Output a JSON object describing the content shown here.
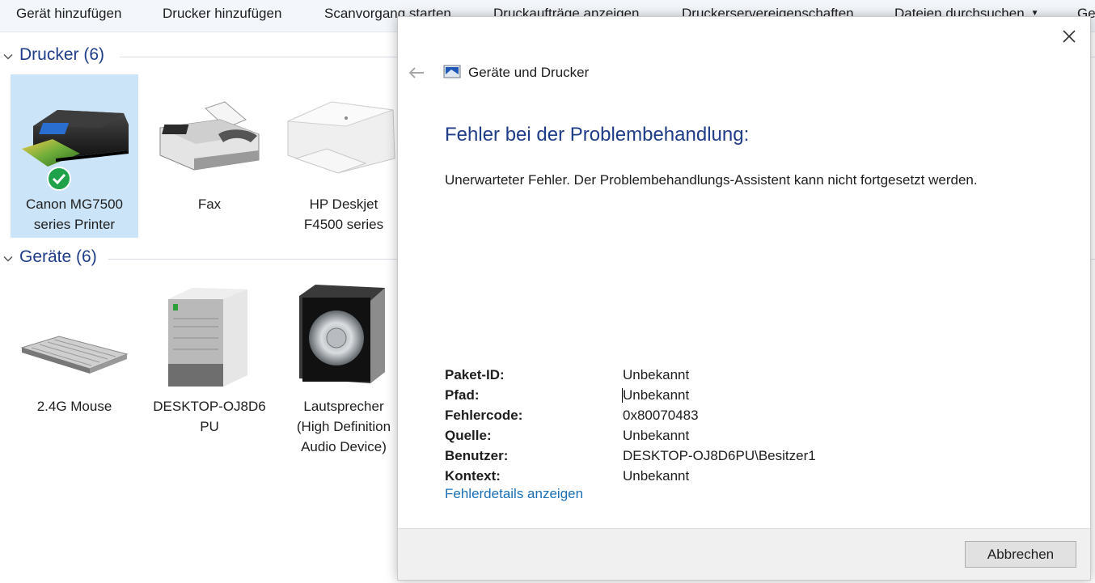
{
  "toolbar": {
    "items": [
      {
        "label": "Gerät hinzufügen"
      },
      {
        "label": "Drucker hinzufügen"
      },
      {
        "label": "Scanvorgang starten"
      },
      {
        "label": "Druckaufträge anzeigen"
      },
      {
        "label": "Druckerservereigenschaften"
      },
      {
        "label": "Dateien durchsuchen"
      },
      {
        "label": "Ge"
      }
    ]
  },
  "groups": {
    "printers": {
      "title": "Drucker (6)"
    },
    "devices": {
      "title": "Geräte (6)"
    }
  },
  "printers": [
    {
      "line1": "Canon MG7500",
      "line2": "series Printer",
      "icon": "printer-icon",
      "status_icon": "default-check-icon"
    },
    {
      "line1": "Fax",
      "line2": "",
      "icon": "fax-icon"
    },
    {
      "line1": "HP Deskjet",
      "line2": "F4500 series",
      "icon": "printer-icon"
    }
  ],
  "devices": [
    {
      "line1": "2.4G Mouse",
      "line2": "",
      "line3": "",
      "icon": "keyboard-icon"
    },
    {
      "line1": "DESKTOP-OJ8D6",
      "line2": "PU",
      "line3": "",
      "icon": "computer-icon"
    },
    {
      "line1": "Lautsprecher",
      "line2": "(High Definition",
      "line3": "Audio Device)",
      "icon": "speaker-icon"
    }
  ],
  "dialog": {
    "nav_title": "Geräte und Drucker",
    "heading": "Fehler bei der Problembehandlung:",
    "message": "Unerwarteter Fehler. Der Problembehandlungs-Assistent kann nicht fortgesetzt werden.",
    "details": [
      {
        "key": "Paket-ID:",
        "value": "Unbekannt"
      },
      {
        "key": "Pfad:",
        "value": "Unbekannt"
      },
      {
        "key": "Fehlercode:",
        "value": "0x80070483"
      },
      {
        "key": "Quelle:",
        "value": "Unbekannt"
      },
      {
        "key": "Benutzer:",
        "value": "DESKTOP-OJ8D6PU\\Besitzer1"
      },
      {
        "key": "Kontext:",
        "value": "Unbekannt"
      }
    ],
    "details_link": "Fehlerdetails anzeigen",
    "cancel_label": "Abbrechen"
  },
  "colors": {
    "accent_heading": "#1e3c87",
    "link": "#1a6fb4",
    "selection": "#cce4f7",
    "default_check": "#1fa24a"
  }
}
